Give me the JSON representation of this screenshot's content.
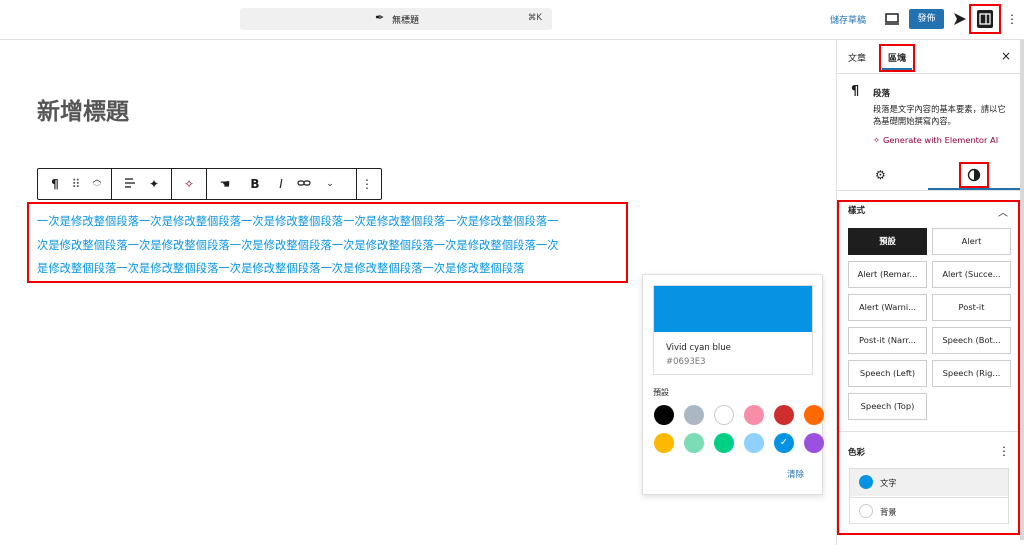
{
  "topbar": {
    "doc_title": "無標題",
    "shortcut": "⌘K",
    "save_draft": "儲存草稿",
    "publish": "發佈"
  },
  "editor": {
    "post_title": "新增標題",
    "paragraph_lines": [
      "一次是修改整個段落一次是修改整個段落一次是修改整個段落一次是修改整個段落一次是修改整個段落一",
      "次是修改整個段落一次是修改整個段落一次是修改整個段落一次是修改整個段落一次是修改整個段落一次",
      "是修改整個段落一次是修改整個段落一次是修改整個段落一次是修改整個段落一次是修改整個段落"
    ],
    "paragraph_color": "#0693e3",
    "toolbar": {
      "bold": "B",
      "italic": "I"
    }
  },
  "color_popover": {
    "selected_name": "Vivid cyan blue",
    "selected_hex": "#0693E3",
    "palette_label": "預設",
    "swatches": [
      {
        "name": "black",
        "color": "#000000"
      },
      {
        "name": "cyan-bluish-gray",
        "color": "#abb8c3"
      },
      {
        "name": "white",
        "color": "#ffffff"
      },
      {
        "name": "pale-pink",
        "color": "#f78da7"
      },
      {
        "name": "vivid-red",
        "color": "#cf2e2e"
      },
      {
        "name": "luminous-vivid-orange",
        "color": "#ff6900"
      },
      {
        "name": "luminous-vivid-amber",
        "color": "#fcb900"
      },
      {
        "name": "light-green-cyan",
        "color": "#7bdcb5"
      },
      {
        "name": "vivid-green-cyan",
        "color": "#00d084"
      },
      {
        "name": "pale-cyan-blue",
        "color": "#8ed1fc"
      },
      {
        "name": "vivid-cyan-blue",
        "color": "#0693e3",
        "selected": true
      },
      {
        "name": "vivid-purple",
        "color": "#9b51e0"
      }
    ],
    "clear": "清除"
  },
  "sidebar": {
    "tab_post": "文章",
    "tab_block": "區塊",
    "block_name": "段落",
    "block_desc": "段落是文字內容的基本要素，請以它為基礎開始撰寫內容。",
    "ai_link": "Generate with Elementor AI",
    "styles_heading": "樣式",
    "styles": [
      {
        "label": "預設",
        "selected": true
      },
      {
        "label": "Alert"
      },
      {
        "label": "Alert (Remar..."
      },
      {
        "label": "Alert (Succe..."
      },
      {
        "label": "Alert (Warni..."
      },
      {
        "label": "Post-it"
      },
      {
        "label": "Post-it (Narr..."
      },
      {
        "label": "Speech (Bot..."
      },
      {
        "label": "Speech (Left)"
      },
      {
        "label": "Speech (Rig..."
      },
      {
        "label": "Speech (Top)"
      }
    ],
    "color_heading": "色彩",
    "color_text": "文字",
    "color_text_value": "#0693e3",
    "color_bg": "背景"
  }
}
